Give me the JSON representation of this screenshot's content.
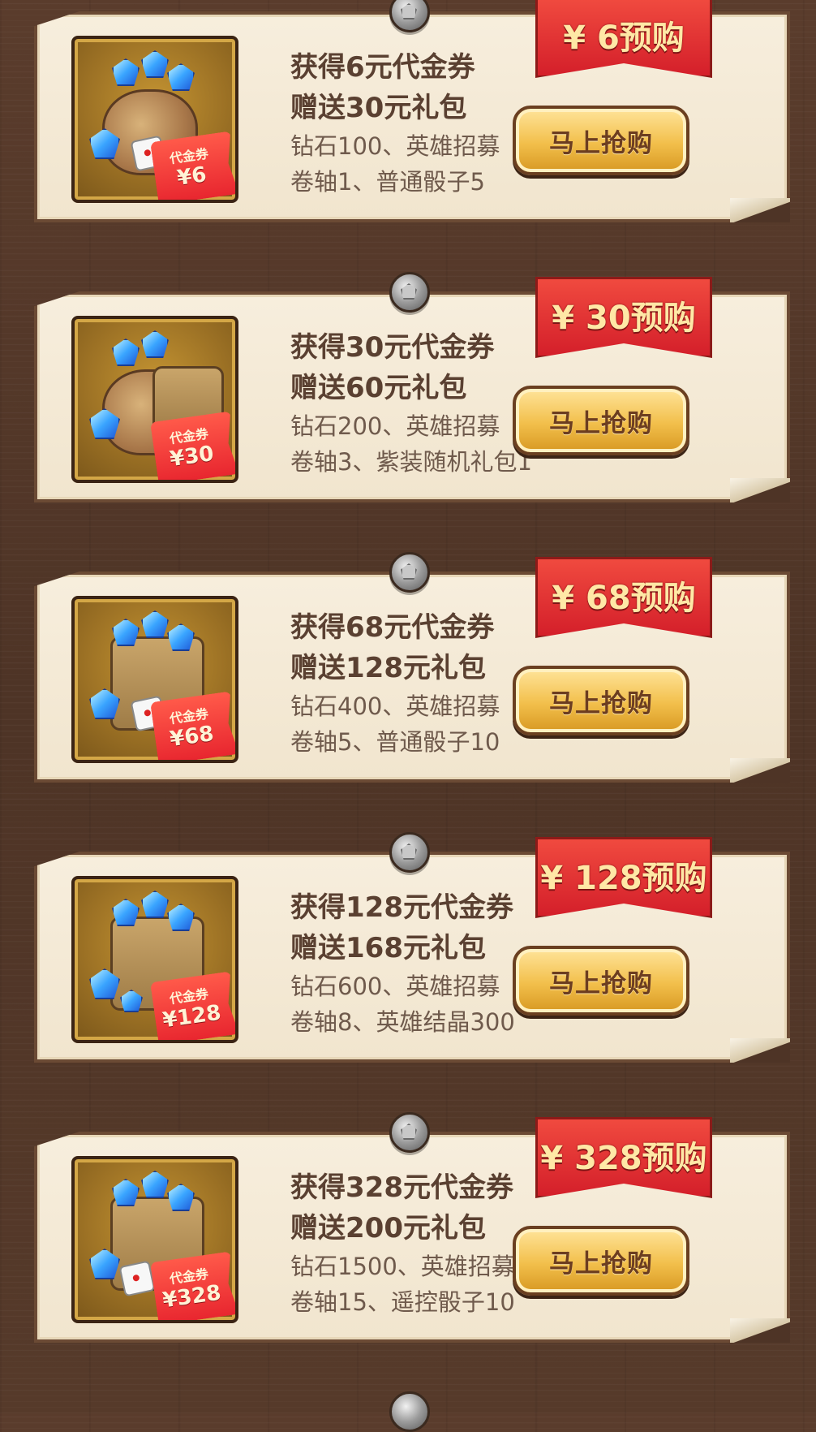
{
  "cards": [
    {
      "title": "获得6元代金券",
      "subtitle": "赠送30元礼包",
      "desc1": "钻石100、英雄招募",
      "desc2": "卷轴1、普通骰子5",
      "price": "¥ 6预购",
      "button": "马上抢购",
      "voucher_label": "代金券",
      "voucher_value": "¥6",
      "icon": "gem-bag-dice-icon"
    },
    {
      "title": "获得30元代金券",
      "subtitle": "赠送60元礼包",
      "desc1": "钻石200、英雄招募",
      "desc2": "卷轴3、紫装随机礼包1",
      "price": "¥ 30预购",
      "button": "马上抢购",
      "voucher_label": "代金券",
      "voucher_value": "¥30",
      "icon": "gem-bag-chest-icon"
    },
    {
      "title": "获得68元代金券",
      "subtitle": "赠送128元礼包",
      "desc1": "钻石400、英雄招募",
      "desc2": "卷轴5、普通骰子10",
      "price": "¥ 68预购",
      "button": "马上抢购",
      "voucher_label": "代金券",
      "voucher_value": "¥68",
      "icon": "gem-crate-dice-icon"
    },
    {
      "title": "获得128元代金券",
      "subtitle": "赠送168元礼包",
      "desc1": "钻石600、英雄招募",
      "desc2": "卷轴8、英雄结晶300",
      "price": "¥ 128预购",
      "button": "马上抢购",
      "voucher_label": "代金券",
      "voucher_value": "¥128",
      "icon": "gem-crate-scroll-icon"
    },
    {
      "title": "获得328元代金券",
      "subtitle": "赠送200元礼包",
      "desc1": "钻石1500、英雄招募",
      "desc2": "卷轴15、遥控骰子10",
      "price": "¥ 328预购",
      "button": "马上抢购",
      "voucher_label": "代金券",
      "voucher_value": "¥328",
      "icon": "gem-crate-remote-dice-icon"
    }
  ]
}
